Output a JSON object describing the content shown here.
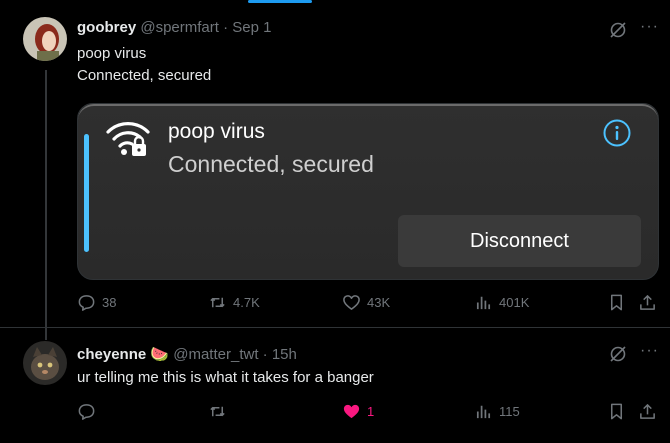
{
  "tweet1": {
    "name": "goobrey",
    "handle": "@spermfart",
    "separator": "·",
    "time": "Sep 1",
    "lines": [
      "poop virus",
      "Connected, secured"
    ],
    "card": {
      "title": "poop virus",
      "subtitle": "Connected, secured",
      "button": "Disconnect",
      "accent_color": "#4cc2ff"
    },
    "stats": {
      "replies": "38",
      "reposts": "4.7K",
      "likes": "43K",
      "views": "401K"
    }
  },
  "tweet2": {
    "name": "cheyenne",
    "emoji": "🍉",
    "handle": "@matter_twt",
    "separator": "·",
    "time": "15h",
    "text": "ur telling me this is what it takes for a banger",
    "stats": {
      "replies": "",
      "reposts": "",
      "likes": "1",
      "views": "115"
    },
    "liked": true
  },
  "colors": {
    "accent": "#1d9bf0",
    "like": "#f91880",
    "muted": "#71767b"
  },
  "icons": {
    "more": "more-icon",
    "grok": "grok-icon",
    "reply": "reply-icon",
    "repost": "repost-icon",
    "like": "heart-icon",
    "views": "views-icon",
    "bookmark": "bookmark-icon",
    "share": "share-icon",
    "wifi": "wifi-lock-icon",
    "info": "info-icon"
  }
}
